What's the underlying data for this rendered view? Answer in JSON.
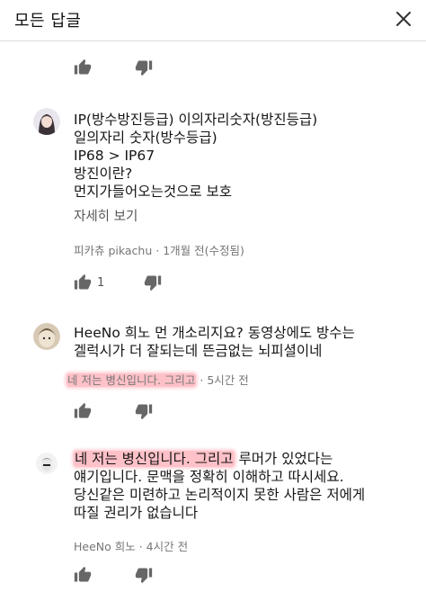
{
  "header": {
    "title": "모든 답글"
  },
  "comments": [
    {
      "lines": [
        "IP(방수방진등급)  이의자리숫자(방진등급)",
        "일의자리 숫자(방수등급)",
        "IP68 > IP67",
        "방진이란?",
        "먼지가들어오는것으로 보호"
      ],
      "read_more": "자세히 보기",
      "meta": "피카츄 pikachu · 1개월 전(수정됨)",
      "like_count": "1"
    },
    {
      "lines": [
        "HeeNo 희노 먼 개소리지요? 동영상에도 방수는",
        "겔럭시가 더 잘되는데 뜬금없는 뇌피셜이네"
      ],
      "highlight": "네 저는 병신입니다. 그리고",
      "meta_suffix": " · 5시간 전"
    },
    {
      "highlight": "네 저는 병신입니다. 그리고",
      "first_rest": " 루머가 있었다는",
      "lines": [
        "얘기입니다. 문맥을 정확히 이해하고 따시세요.",
        "당신같은 미련하고 논리적이지 못한 사람은 저에게",
        "따질 권리가 없습니다"
      ],
      "meta": "HeeNo 희노 · 4시간 전"
    }
  ],
  "icons": {
    "like": "thumbs-up-icon",
    "dislike": "thumbs-down-icon",
    "close": "close-icon"
  },
  "colors": {
    "highlight": "#ffc1c8",
    "meta": "#767676",
    "icon": "#666666"
  }
}
